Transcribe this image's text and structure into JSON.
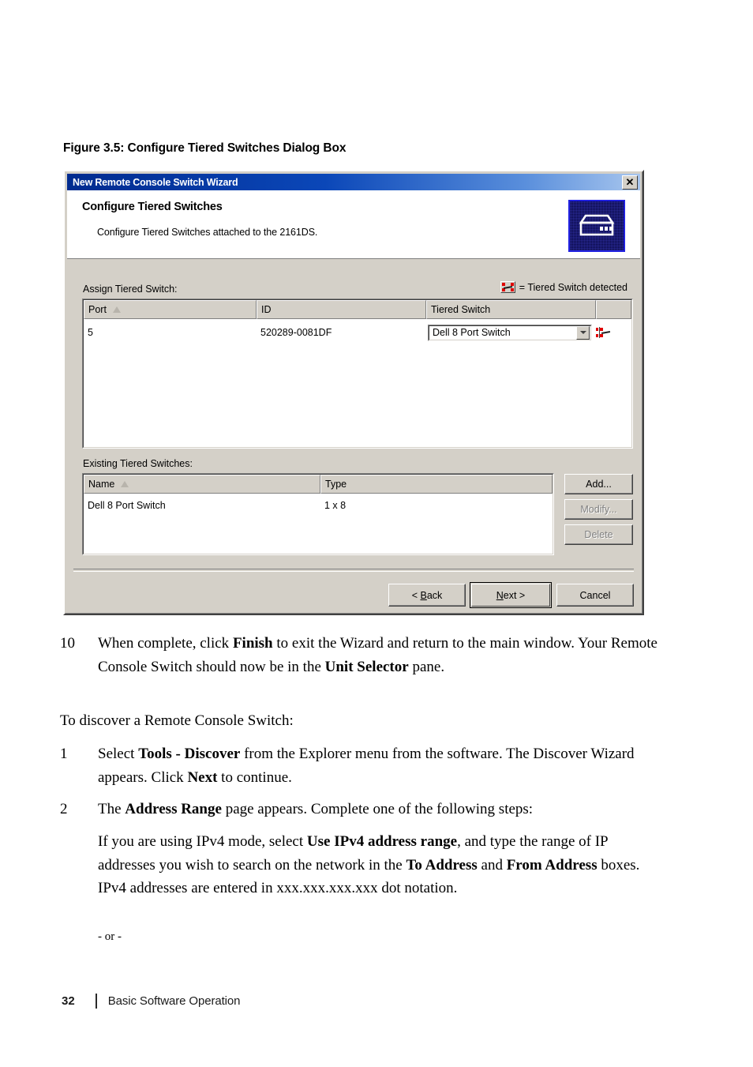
{
  "figure": {
    "caption": "Figure 3.5: Configure Tiered Switches Dialog Box"
  },
  "dialog": {
    "titlebar": {
      "title": "New Remote Console Switch Wizard",
      "close_label": "✕"
    },
    "header": {
      "heading": "Configure Tiered Switches",
      "description": "Configure Tiered Switches attached to the 2161DS."
    },
    "assign_section": {
      "label": "Assign Tiered Switch:",
      "legend_text": "= Tiered Switch detected",
      "legend_icon": "tiered-switch-detected-icon",
      "columns": [
        "Port",
        "ID",
        "Tiered Switch",
        ""
      ],
      "sort_column": "Port",
      "sort_direction": "ascending",
      "rows": [
        {
          "port": "5",
          "id": "520289-0081DF",
          "tiered_switch": "Dell 8 Port Switch",
          "detected": true
        }
      ]
    },
    "existing_section": {
      "label": "Existing Tiered Switches:",
      "columns": [
        "Name",
        "Type"
      ],
      "sort_column": "Name",
      "sort_direction": "ascending",
      "rows": [
        {
          "name": "Dell 8 Port Switch",
          "type": "1 x 8"
        }
      ],
      "buttons": [
        {
          "label": "Add...",
          "enabled": true
        },
        {
          "label": "Modify...",
          "enabled": false
        },
        {
          "label": "Delete",
          "enabled": false
        }
      ]
    },
    "footer_buttons": {
      "back": "< Back",
      "next": "Next >",
      "cancel": "Cancel"
    },
    "colors": {
      "face": "#d4d0c8",
      "titlebar_start": "#002b8f",
      "titlebar_end": "#a8c6ee",
      "detected_node": "#e00000",
      "artwork_background": "#04043c",
      "artwork_border": "#2020e0"
    }
  },
  "document": {
    "step10": {
      "number": "10",
      "parts": [
        {
          "t": "When complete, click ",
          "b": false
        },
        {
          "t": "Finish",
          "b": true
        },
        {
          "t": " to exit the Wizard and return to the main window. Your Remote Console Switch should now be in the ",
          "b": false
        },
        {
          "t": "Unit Selector",
          "b": true
        },
        {
          "t": " pane.",
          "b": false
        }
      ]
    },
    "lead_in": "To discover a Remote Console Switch:",
    "step1": {
      "number": "1",
      "parts": [
        {
          "t": "Select ",
          "b": false
        },
        {
          "t": "Tools - Discover",
          "b": true
        },
        {
          "t": " from the Explorer menu from the software. The Discover Wizard appears. Click ",
          "b": false
        },
        {
          "t": "Next",
          "b": true
        },
        {
          "t": " to continue.",
          "b": false
        }
      ]
    },
    "step2": {
      "number": "2",
      "parts": [
        {
          "t": "The ",
          "b": false
        },
        {
          "t": "Address Range",
          "b": true
        },
        {
          "t": " page appears. Complete one of the following steps:",
          "b": false
        }
      ]
    },
    "step2_body": {
      "parts": [
        {
          "t": "If you are using IPv4 mode, select ",
          "b": false
        },
        {
          "t": "Use IPv4 address range",
          "b": true
        },
        {
          "t": ", and type the range of IP addresses you wish to search on the network in the ",
          "b": false
        },
        {
          "t": "To Address",
          "b": true
        },
        {
          "t": " and ",
          "b": false
        },
        {
          "t": "From Address",
          "b": true
        },
        {
          "t": " boxes. IPv4 addresses are entered in xxx.xxx.xxx.xxx dot notation.",
          "b": false
        }
      ]
    },
    "or_separator": "- or -"
  },
  "page_footer": {
    "page_number": "32",
    "section_title": "Basic Software Operation"
  }
}
